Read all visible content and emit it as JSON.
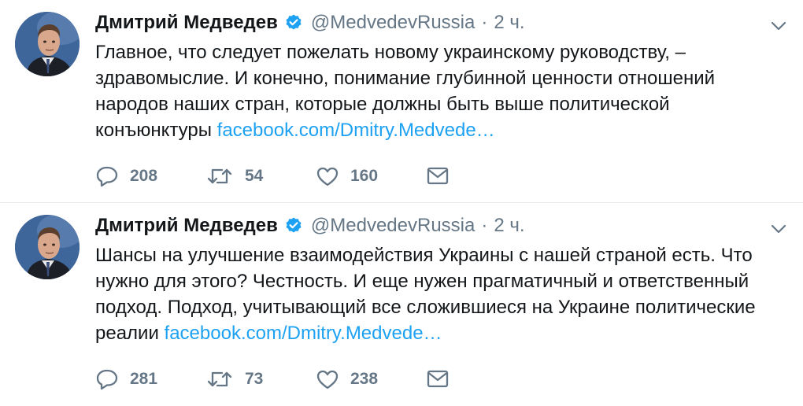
{
  "tweets": [
    {
      "author_name": "Дмитрий Медведев",
      "handle": "@MedvedevRussia",
      "separator": "·",
      "time": "2 ч.",
      "text_lines": [
        "Главное, что следует пожелать новому украинскому руководству, –",
        "здравомыслие. И конечно, понимание глубинной ценности отношений",
        "народов наших стран, которые должны быть выше политической"
      ],
      "last_line_text": "конъюнктуры ",
      "link_text": "facebook.com/Dmitry.Medvede…",
      "replies": "208",
      "retweets": "54",
      "likes": "160"
    },
    {
      "author_name": "Дмитрий Медведев",
      "handle": "@MedvedevRussia",
      "separator": "·",
      "time": "2 ч.",
      "text_lines": [
        "Шансы на улучшение взаимодействия Украины с нашей страной есть. Что",
        "нужно для этого? Честность. И еще нужен прагматичный и ответственный",
        "подход. Подход, учитывающий все сложившиеся на Украине политические"
      ],
      "last_line_text": "реалии ",
      "link_text": "facebook.com/Dmitry.Medvede…",
      "replies": "281",
      "retweets": "73",
      "likes": "238"
    }
  ],
  "colors": {
    "text": "#14171a",
    "secondary": "#657786",
    "link": "#1da1f2",
    "verified": "#1da1f2",
    "divider": "#e6ecf0"
  },
  "icons": [
    "verified-badge-icon",
    "chevron-down-icon",
    "reply-icon",
    "retweet-icon",
    "like-icon",
    "direct-message-icon"
  ]
}
